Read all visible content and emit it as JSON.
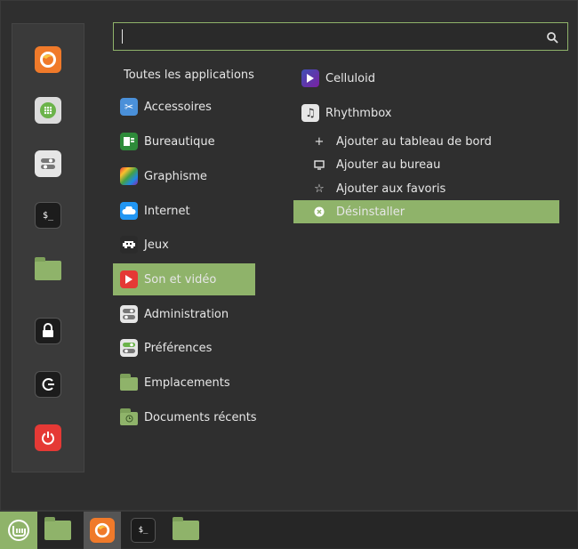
{
  "search": {
    "placeholder": ""
  },
  "categories_header": "Toutes les applications",
  "categories": [
    {
      "label": "Accessoires",
      "icon": "accessories-icon"
    },
    {
      "label": "Bureautique",
      "icon": "office-icon"
    },
    {
      "label": "Graphisme",
      "icon": "graphics-icon"
    },
    {
      "label": "Internet",
      "icon": "internet-icon"
    },
    {
      "label": "Jeux",
      "icon": "games-icon"
    },
    {
      "label": "Son et vidéo",
      "icon": "sound-video-icon"
    },
    {
      "label": "Administration",
      "icon": "administration-icon"
    },
    {
      "label": "Préférences",
      "icon": "preferences-icon"
    },
    {
      "label": "Emplacements",
      "icon": "places-folder-icon"
    },
    {
      "label": "Documents récents",
      "icon": "recent-documents-icon"
    }
  ],
  "apps": [
    {
      "label": "Celluloid",
      "icon": "celluloid-icon"
    },
    {
      "label": "Rhythmbox",
      "icon": "rhythmbox-icon"
    }
  ],
  "context_menu": [
    {
      "label": "Ajouter au tableau de bord",
      "icon": "plus-icon"
    },
    {
      "label": "Ajouter au bureau",
      "icon": "desktop-icon"
    },
    {
      "label": "Ajouter aux favoris",
      "icon": "star-icon"
    },
    {
      "label": "Désinstaller",
      "icon": "uninstall-icon"
    }
  ],
  "colors": {
    "accent": "#8fb36a",
    "background": "#2f2f2f"
  }
}
